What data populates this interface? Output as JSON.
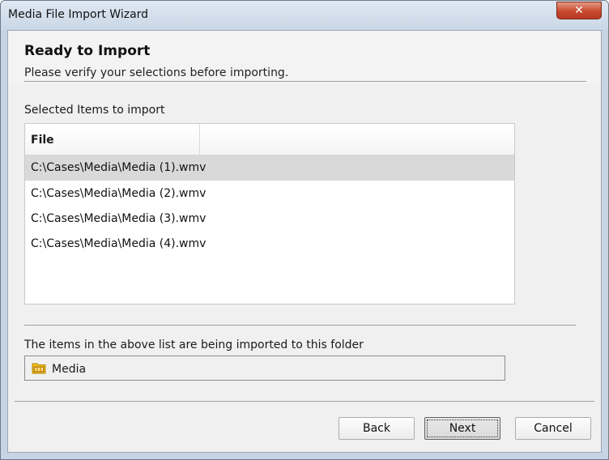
{
  "window": {
    "title": "Media File Import Wizard",
    "close_glyph": "✕"
  },
  "header": {
    "title": "Ready to Import",
    "subtitle": "Please verify your selections before importing."
  },
  "selected_items": {
    "label": "Selected Items to import",
    "columns": [
      "File",
      ""
    ],
    "rows": [
      {
        "file": "C:\\Cases\\Media\\Media (1).wmv",
        "selected": true
      },
      {
        "file": "C:\\Cases\\Media\\Media (2).wmv",
        "selected": false
      },
      {
        "file": "C:\\Cases\\Media\\Media (3).wmv",
        "selected": false
      },
      {
        "file": "C:\\Cases\\Media\\Media (4).wmv",
        "selected": false
      }
    ]
  },
  "destination": {
    "label": "The items in the above list are being imported to this folder",
    "folder_name": "Media",
    "folder_icon": "media-folder-icon"
  },
  "buttons": {
    "back": "Back",
    "next": "Next",
    "cancel": "Cancel"
  },
  "colors": {
    "selected_row": "#d9d9d9",
    "close_button": "#c8482d",
    "folder_icon": "#f2c21b"
  }
}
